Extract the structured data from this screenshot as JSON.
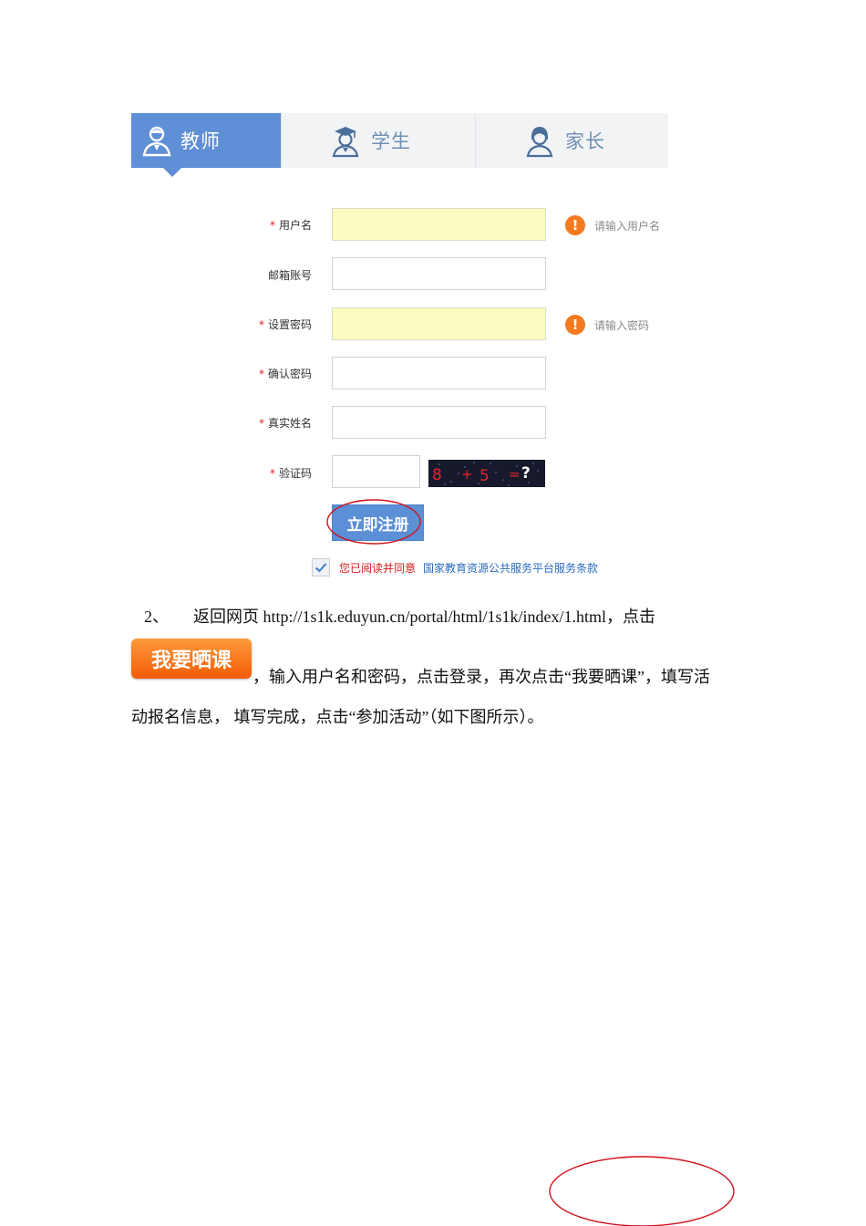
{
  "tabs": [
    {
      "label": "教师",
      "icon": "teacher-icon",
      "active": true
    },
    {
      "label": "学生",
      "icon": "student-icon",
      "active": false
    },
    {
      "label": "家长",
      "icon": "parent-icon",
      "active": false
    }
  ],
  "form": {
    "fields": [
      {
        "label": "用户名",
        "required": true,
        "hint": "请输入用户名",
        "value": ""
      },
      {
        "label": "邮箱账号",
        "required": false,
        "value": ""
      },
      {
        "label": "设置密码",
        "required": true,
        "hint": "请输入密码",
        "value": ""
      },
      {
        "label": "确认密码",
        "required": true,
        "value": ""
      },
      {
        "label": "真实姓名",
        "required": true,
        "value": ""
      },
      {
        "label": "验证码",
        "required": true,
        "value": ""
      }
    ],
    "required_mark": "*",
    "captcha": {
      "a": "8",
      "op": "+",
      "b": "5",
      "eq": "=",
      "q": "?"
    },
    "register_label": "立即注册",
    "agree_text": "您已阅读并同意",
    "terms_link": "国家教育资源公共服务平台服务条款"
  },
  "step": {
    "number": "2、",
    "line1": "返回网页 http://1s1k.eduyun.cn/portal/html/1s1k/index/1.html，点击",
    "button_label": "我要晒课",
    "line2": "，输入用户名和密码，点击登录，再次点击“我要晒课”，填写活",
    "line3": "动报名信息，  填写完成，点击“参加活动”（如下图所示）。"
  },
  "colors": {
    "tab_active": "#5f8fd6",
    "required": "#e02020",
    "warning": "#f47a20",
    "error_input_bg": "#fbfdc0",
    "link": "#2a6bbf",
    "annotation_circle": "#d0121c"
  }
}
